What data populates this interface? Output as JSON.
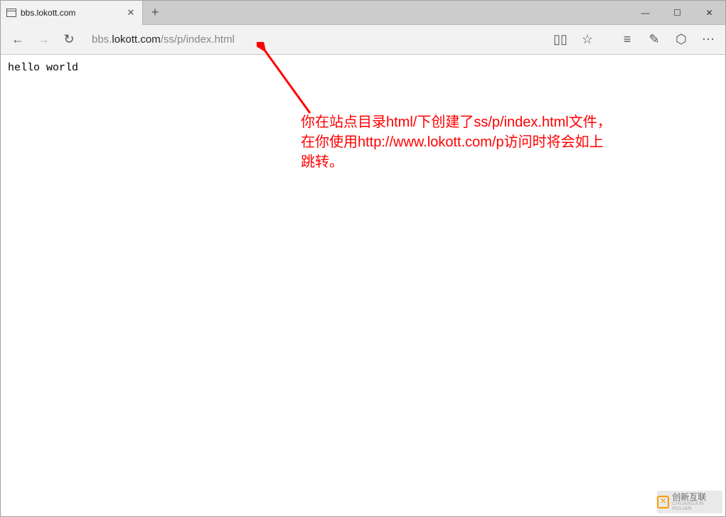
{
  "tab": {
    "title": "bbs.lokott.com"
  },
  "window_controls": {
    "minimize": "—",
    "maximize": "☐",
    "close": "✕"
  },
  "toolbar": {
    "new_tab": "+",
    "back": "←",
    "forward": "→",
    "refresh": "↻",
    "reading": "▯▯",
    "favorite": "☆",
    "hub": "≡",
    "notes": "✎",
    "share": "⬡",
    "more": "⋯"
  },
  "url": {
    "prefix": "bbs.",
    "domain": "lokott.com",
    "path": "/ss/p/index.html"
  },
  "page": {
    "body_text": "hello world"
  },
  "annotation": {
    "text": "你在站点目录html/下创建了ss/p/index.html文件，在你使用http://www.lokott.com/p访问时将会如上跳转。"
  },
  "watermark": {
    "cn": "创新互联",
    "en": "CHUANGXIN HULIAN"
  }
}
